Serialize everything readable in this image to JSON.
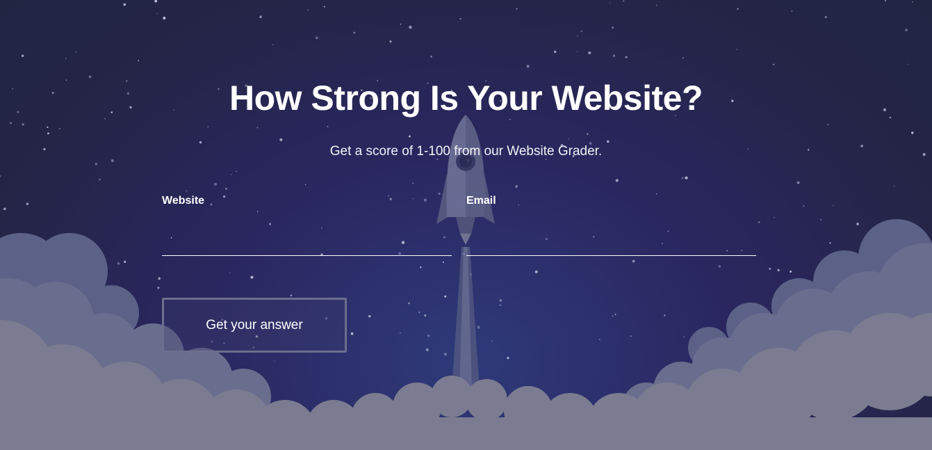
{
  "page": {
    "title": "How Strong Is Your Website?",
    "subtitle": "Get a score of 1-100 from our Website Grader."
  },
  "form": {
    "website": {
      "label": "Website",
      "value": "",
      "placeholder": ""
    },
    "email": {
      "label": "Email",
      "value": "",
      "placeholder": ""
    },
    "submit_label": "Get your answer"
  },
  "colors": {
    "sky_top": "#222542",
    "sky_mid": "#2a2760",
    "sky_glow": "#2f3a7a",
    "cloud_back": "#5b6187",
    "cloud_mid": "#6a6e8e",
    "cloud_front": "#7b7c91",
    "rocket": "#6f7394",
    "text": "#ffffff"
  },
  "illustration": {
    "icons": [
      "rocket-icon",
      "stars",
      "clouds"
    ]
  }
}
